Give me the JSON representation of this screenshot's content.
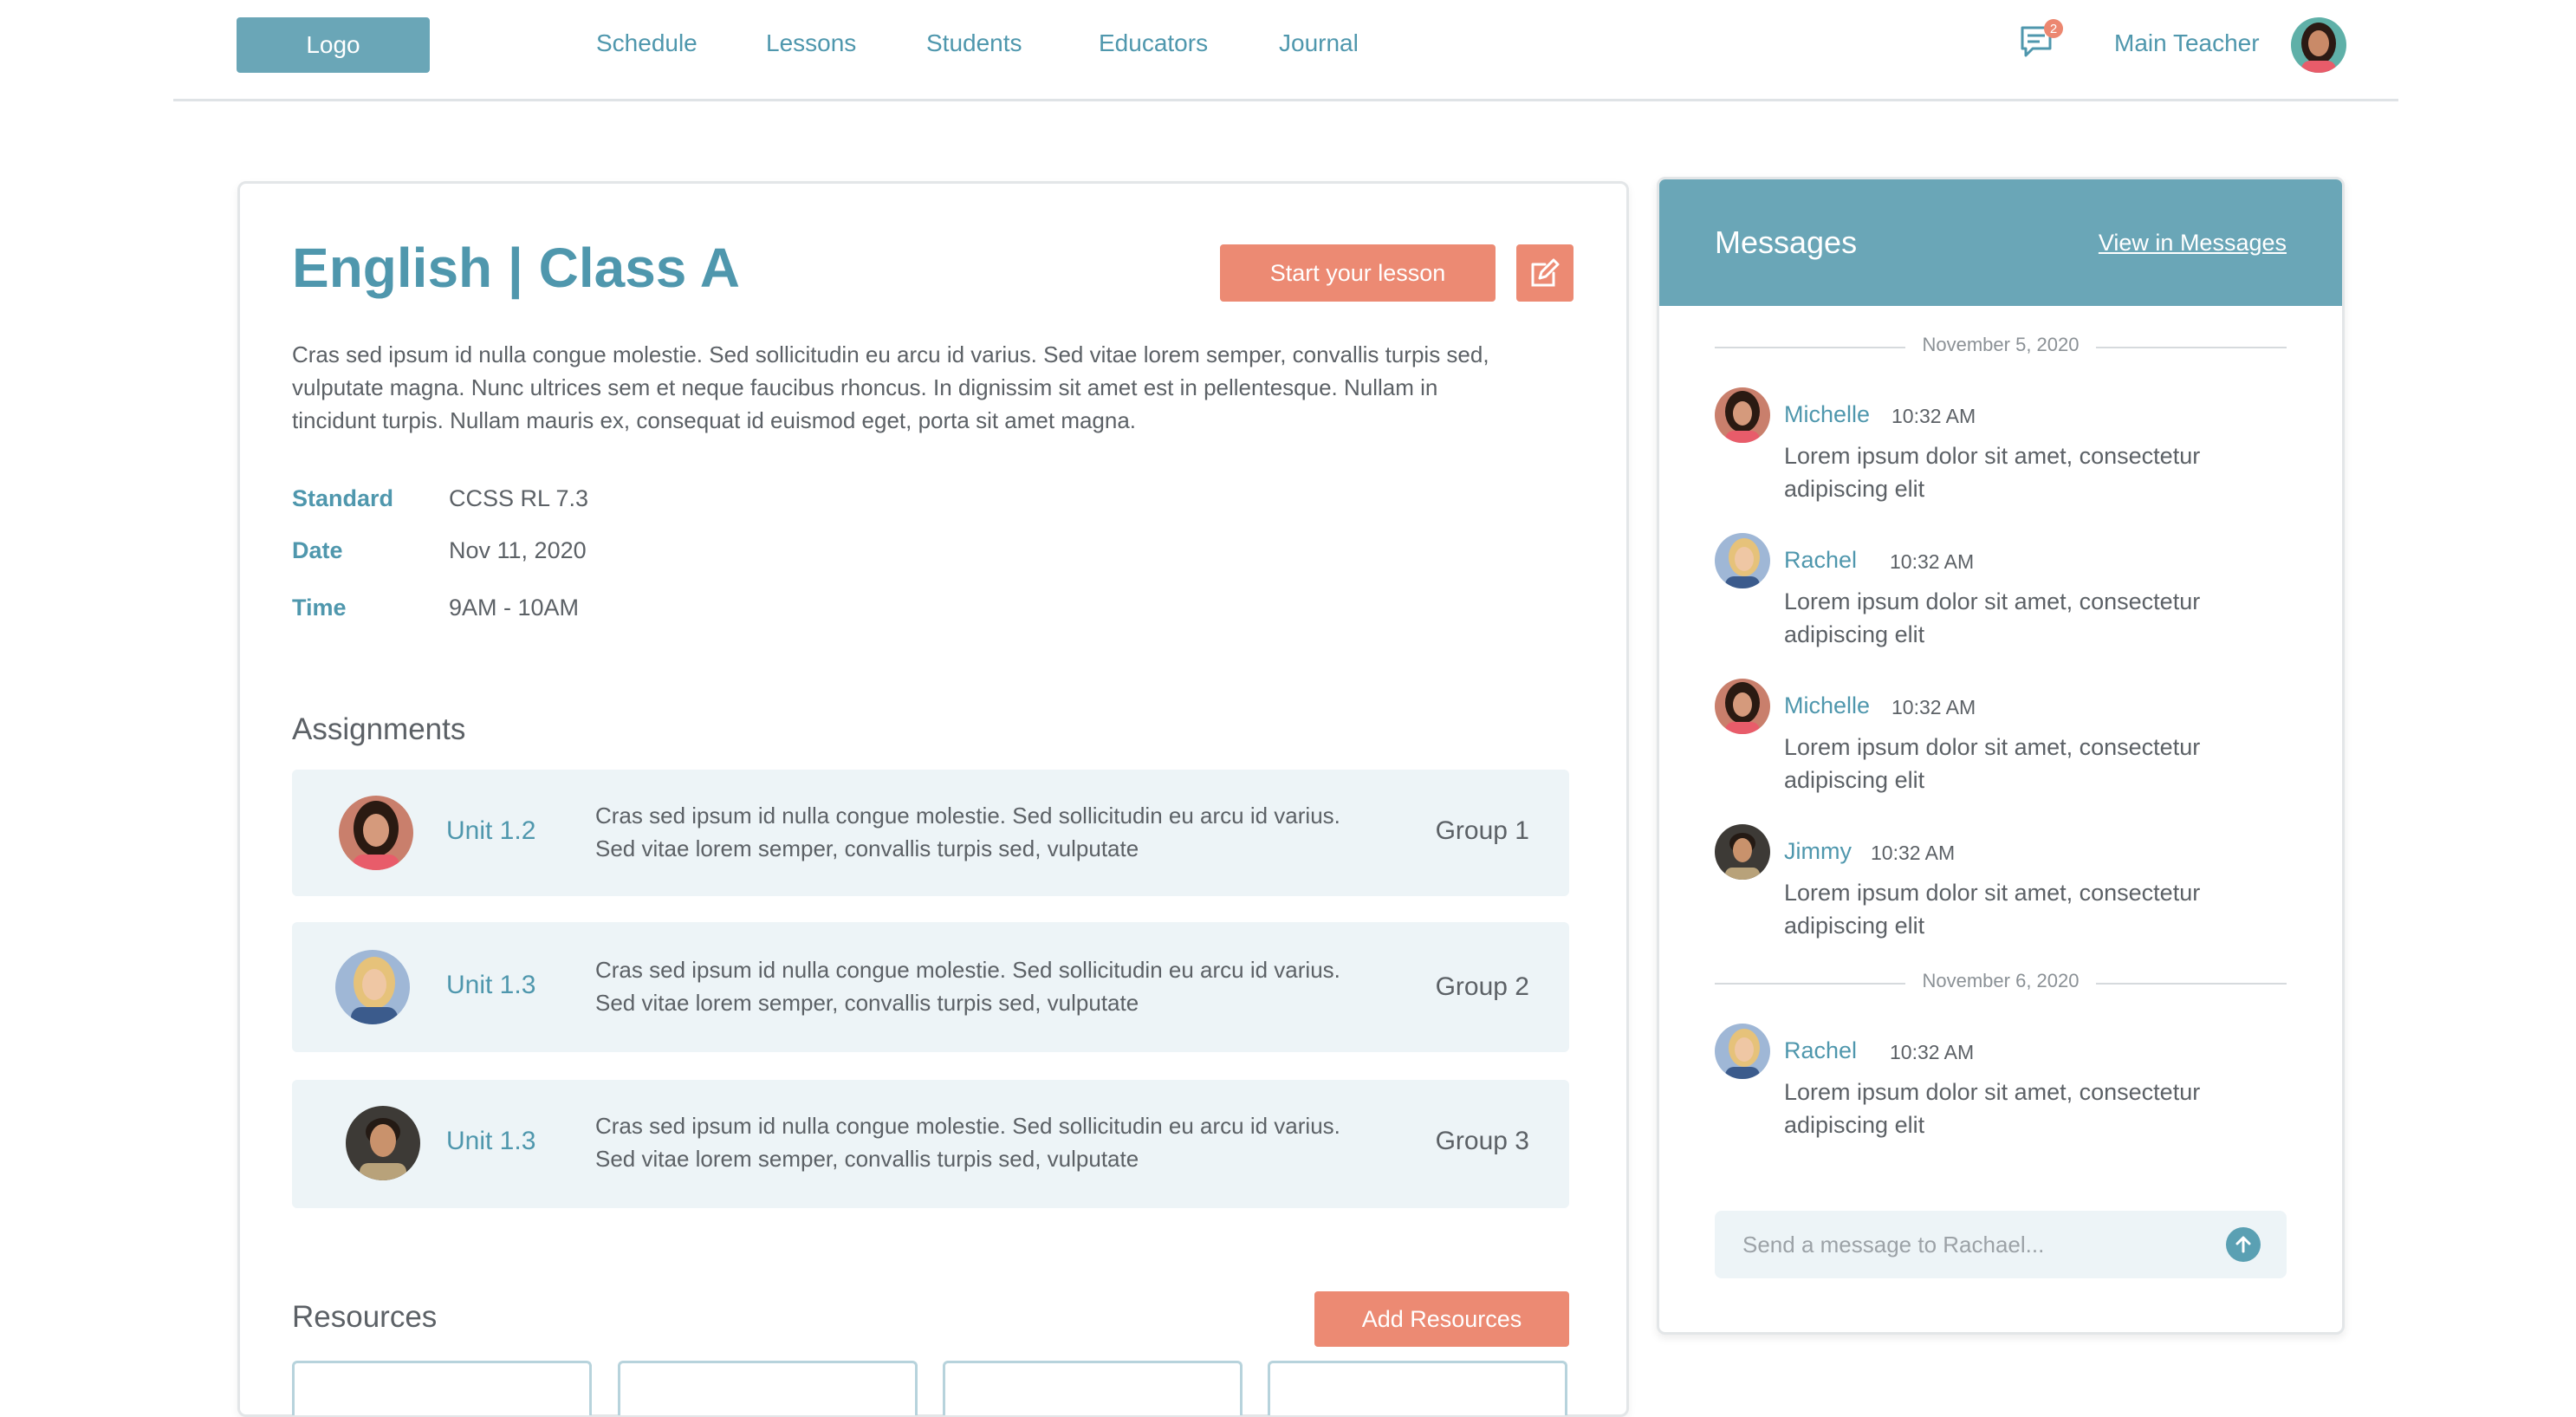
{
  "nav": {
    "logo": "Logo",
    "links": [
      "Schedule",
      "Lessons",
      "Students",
      "Educators",
      "Journal"
    ],
    "notification_count": "2",
    "user_name": "Main Teacher"
  },
  "lesson": {
    "title": "English | Class A",
    "start_button": "Start your lesson",
    "description": "Cras sed ipsum id nulla congue molestie. Sed sollicitudin eu arcu id varius. Sed vitae lorem semper, convallis turpis sed, vulputate magna. Nunc ultrices sem et neque faucibus rhoncus. In dignissim sit amet est in pellentesque. Nullam in tincidunt turpis. Nullam mauris ex, consequat id euismod eget, porta sit amet magna.",
    "meta": [
      {
        "label": "Standard",
        "value": "CCSS RL 7.3"
      },
      {
        "label": "Date",
        "value": "Nov 11, 2020"
      },
      {
        "label": "Time",
        "value": "9AM - 10AM"
      }
    ]
  },
  "assignments": {
    "heading": "Assignments",
    "items": [
      {
        "unit": "Unit 1.2",
        "text": "Cras sed ipsum id nulla congue molestie. Sed sollicitudin eu arcu id varius. Sed vitae lorem semper, convallis turpis sed, vulputate",
        "group": "Group 1"
      },
      {
        "unit": "Unit 1.3",
        "text": "Cras sed ipsum id nulla congue molestie. Sed sollicitudin eu arcu id varius. Sed vitae lorem semper, convallis turpis sed, vulputate",
        "group": "Group 2"
      },
      {
        "unit": "Unit 1.3",
        "text": "Cras sed ipsum id nulla congue molestie. Sed sollicitudin eu arcu id varius. Sed vitae lorem semper, convallis turpis sed, vulputate",
        "group": "Group 3"
      }
    ]
  },
  "resources": {
    "heading": "Resources",
    "add_button": "Add Resources"
  },
  "messages": {
    "title": "Messages",
    "view_link": "View in Messages",
    "dates": [
      "November 5, 2020",
      "November 6, 2020"
    ],
    "items": [
      {
        "name": "Michelle",
        "time": "10:32 AM",
        "text": "Lorem ipsum dolor sit amet, consectetur adipiscing elit"
      },
      {
        "name": "Rachel",
        "time": "10:32 AM",
        "text": "Lorem ipsum dolor sit amet, consectetur adipiscing elit"
      },
      {
        "name": "Michelle",
        "time": "10:32 AM",
        "text": "Lorem ipsum dolor sit amet, consectetur adipiscing elit"
      },
      {
        "name": "Jimmy",
        "time": "10:32 AM",
        "text": "Lorem ipsum dolor sit amet, consectetur adipiscing elit"
      },
      {
        "name": "Rachel",
        "time": "10:32 AM",
        "text": "Lorem ipsum dolor sit amet, consectetur adipiscing elit"
      }
    ],
    "input_placeholder": "Send a message to Rachael..."
  },
  "colors": {
    "accent": "#4f97ad",
    "header": "#6aa6b7",
    "button": "#ec8a73",
    "row_bg": "#edf4f7"
  }
}
